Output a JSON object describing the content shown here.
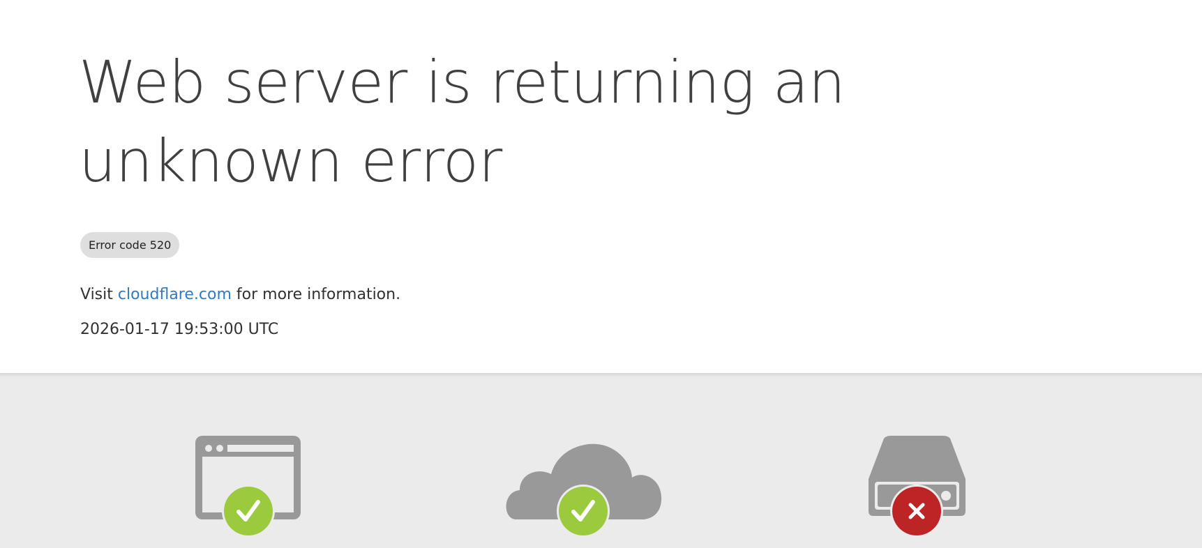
{
  "headline": "Web server is returning an unknown error",
  "error_badge": "Error code 520",
  "info": {
    "prefix": "Visit",
    "link_text": "cloudflare.com",
    "suffix": "for more information."
  },
  "timestamp": "2026-01-17 19:53:00 UTC",
  "status_nodes": [
    {
      "icon": "browser-icon",
      "status": "ok",
      "status_color": "#9bca3e"
    },
    {
      "icon": "cloud-icon",
      "status": "ok",
      "status_color": "#9bca3e"
    },
    {
      "icon": "server-icon",
      "status": "error",
      "status_color": "#bd2426"
    }
  ],
  "colors": {
    "icon_gray": "#999999",
    "link": "#2f7bbf",
    "ok": "#9bca3e",
    "error": "#bd2426"
  }
}
